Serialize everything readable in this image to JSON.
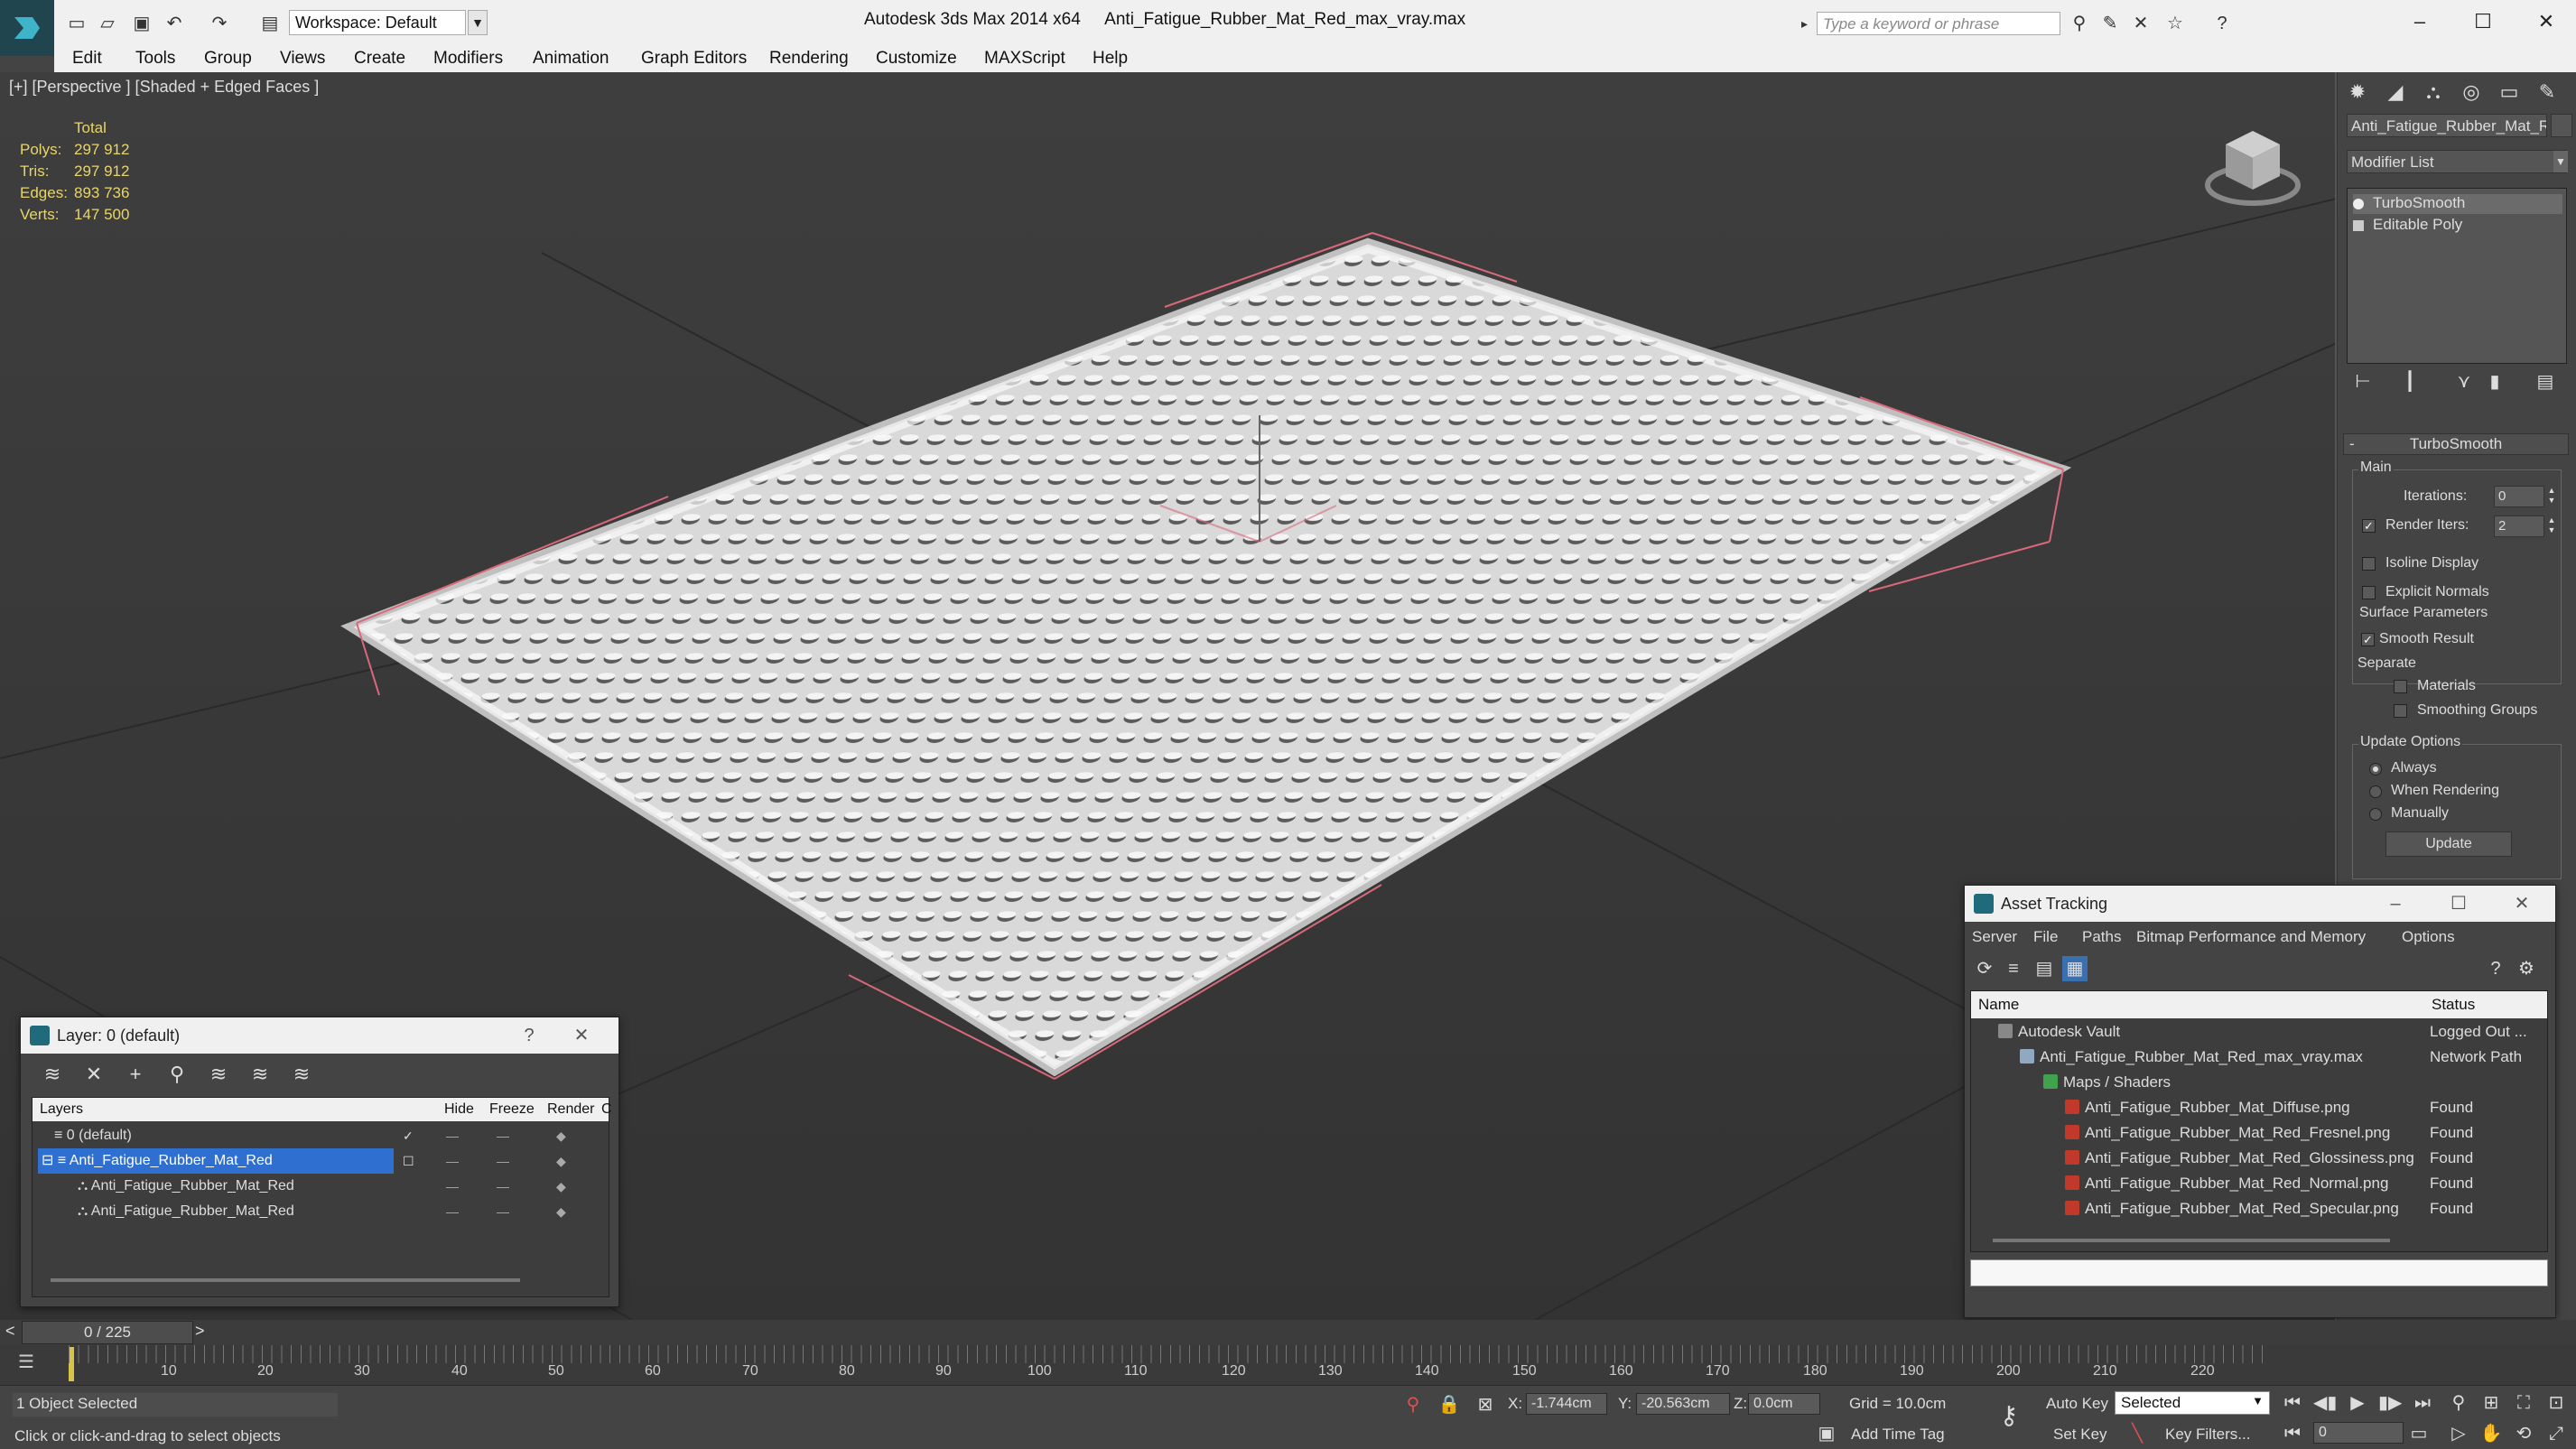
{
  "app": {
    "title": "Autodesk 3ds Max  2014 x64",
    "file": "Anti_Fatigue_Rubber_Mat_Red_max_vray.max",
    "workspace": "Workspace: Default",
    "search_placeholder": "Type a keyword or phrase"
  },
  "menu": [
    "Edit",
    "Tools",
    "Group",
    "Views",
    "Create",
    "Modifiers",
    "Animation",
    "Graph Editors",
    "Rendering",
    "Customize",
    "MAXScript",
    "Help"
  ],
  "viewport": {
    "label": "[+] [Perspective ] [Shaded + Edged Faces ]",
    "stats_header": "Total",
    "stats": [
      {
        "label": "Polys:",
        "value": "297 912"
      },
      {
        "label": "Tris:",
        "value": "297 912"
      },
      {
        "label": "Edges:",
        "value": "893 736"
      },
      {
        "label": "Verts:",
        "value": "147 500"
      }
    ]
  },
  "command_panel": {
    "object_name": "Anti_Fatigue_Rubber_Mat_Re",
    "modifier_list": "Modifier List",
    "stack": [
      "TurboSmooth",
      "Editable Poly"
    ],
    "rollout_title": "TurboSmooth",
    "main_group": "Main",
    "iterations_label": "Iterations:",
    "iterations_value": "0",
    "render_iters_label": "Render Iters:",
    "render_iters_value": "2",
    "isoline_label": "Isoline Display",
    "explicit_normals_label": "Explicit Normals",
    "surface_group": "Surface Parameters",
    "smooth_result_label": "Smooth Result",
    "separate_label": "Separate",
    "materials_label": "Materials",
    "smoothing_groups_label": "Smoothing Groups",
    "update_group": "Update Options",
    "always_label": "Always",
    "when_rendering_label": "When Rendering",
    "manually_label": "Manually",
    "update_button": "Update"
  },
  "layer_window": {
    "title": "Layer: 0 (default)",
    "help": "?",
    "columns": [
      "Layers",
      "Hide",
      "Freeze",
      "Render",
      "C"
    ],
    "rows": [
      {
        "name": "0 (default)",
        "selected": false
      },
      {
        "name": "Anti_Fatigue_Rubber_Mat_Red",
        "selected": true
      },
      {
        "name": "Anti_Fatigue_Rubber_Mat_Red",
        "selected": false
      },
      {
        "name": "Anti_Fatigue_Rubber_Mat_Red",
        "selected": false
      }
    ]
  },
  "asset_tracking": {
    "title": "Asset Tracking",
    "menu": [
      "Server",
      "File",
      "Paths",
      "Bitmap Performance and Memory",
      "Options"
    ],
    "columns": [
      "Name",
      "Status"
    ],
    "rows": [
      {
        "name": "Autodesk Vault",
        "status": "Logged Out ..."
      },
      {
        "name": "Anti_Fatigue_Rubber_Mat_Red_max_vray.max",
        "status": "Network Path"
      },
      {
        "name": "Maps / Shaders",
        "status": ""
      },
      {
        "name": "Anti_Fatigue_Rubber_Mat_Diffuse.png",
        "status": "Found"
      },
      {
        "name": "Anti_Fatigue_Rubber_Mat_Red_Fresnel.png",
        "status": "Found"
      },
      {
        "name": "Anti_Fatigue_Rubber_Mat_Red_Glossiness.png",
        "status": "Found"
      },
      {
        "name": "Anti_Fatigue_Rubber_Mat_Red_Normal.png",
        "status": "Found"
      },
      {
        "name": "Anti_Fatigue_Rubber_Mat_Red_Specular.png",
        "status": "Found"
      }
    ]
  },
  "timeline": {
    "frame": "0 / 225",
    "ticks": [
      "10",
      "20",
      "30",
      "40",
      "50",
      "60",
      "70",
      "80",
      "90",
      "100",
      "110",
      "120",
      "130",
      "140",
      "150",
      "160",
      "170",
      "180",
      "190",
      "200",
      "210",
      "220"
    ]
  },
  "status": {
    "selected": "1 Object Selected",
    "prompt": "Click or click-and-drag to select objects",
    "x_label": "X:",
    "x_value": "-1.744cm",
    "y_label": "Y:",
    "y_value": "-20.563cm",
    "z_label": "Z:",
    "z_value": "0.0cm",
    "grid": "Grid = 10.0cm",
    "add_time_tag": "Add Time Tag",
    "auto_key": "Auto Key",
    "set_key": "Set Key",
    "selected_mode": "Selected",
    "key_filters": "Key Filters...",
    "frame_field": "0"
  }
}
